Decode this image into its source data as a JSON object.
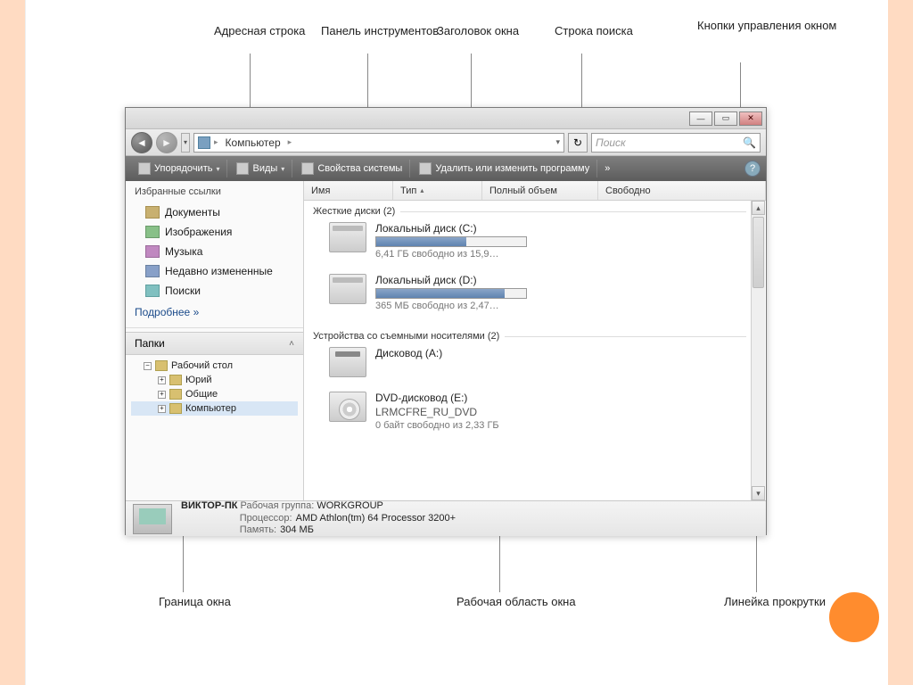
{
  "callouts": {
    "address_bar": "Адресная строка",
    "toolbar": "Панель инструментов",
    "title": "Заголовок окна",
    "search": "Строка поиска",
    "win_buttons": "Кнопки управления окном",
    "border": "Граница окна",
    "workarea": "Рабочая область окна",
    "scrollbar": "Линейка прокрутки"
  },
  "nav": {
    "breadcrumb_root": "Компьютер",
    "search_placeholder": "Поиск"
  },
  "toolbar": {
    "organize": "Упорядочить",
    "views": "Виды",
    "sys_props": "Свойства системы",
    "uninstall": "Удалить или изменить программу"
  },
  "sidebar": {
    "fav_header": "Избранные ссылки",
    "items": {
      "docs": "Документы",
      "pics": "Изображения",
      "music": "Музыка",
      "recent": "Недавно измененные",
      "search": "Поиски"
    },
    "more": "Подробнее  »",
    "folders_header": "Папки",
    "tree": {
      "desktop": "Рабочий стол",
      "user": "Юрий",
      "public": "Общие",
      "computer": "Компьютер"
    }
  },
  "columns": {
    "name": "Имя",
    "type": "Тип",
    "total": "Полный объем",
    "free": "Свободно"
  },
  "groups": {
    "hdd": "Жесткие диски (2)",
    "removable": "Устройства со съемными носителями (2)"
  },
  "drives": {
    "c": {
      "name": "Локальный диск (C:)",
      "sub": "6,41 ГБ свободно из 15,9…",
      "fill": 60
    },
    "d": {
      "name": "Локальный диск (D:)",
      "sub": "365 МБ свободно из 2,47…",
      "fill": 86
    },
    "a": {
      "name": "Дисковод (A:)"
    },
    "e": {
      "name": "DVD-дисковод (E:)",
      "label": "LRMCFRE_RU_DVD",
      "sub": "0 байт свободно из 2,33 ГБ"
    }
  },
  "status": {
    "pc": "ВИКТОР-ПК",
    "workgroup_k": "Рабочая группа:",
    "workgroup_v": "WORKGROUP",
    "cpu_k": "Процессор:",
    "cpu_v": "AMD Athlon(tm) 64 Processor 3200+",
    "mem_k": "Память:",
    "mem_v": "304 МБ"
  }
}
